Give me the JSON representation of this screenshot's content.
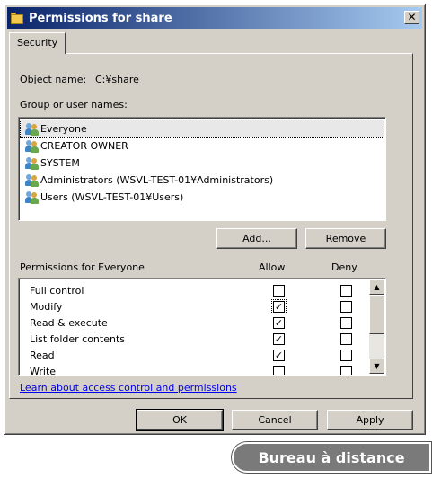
{
  "window": {
    "title": "Permissions for share"
  },
  "tabs": [
    {
      "label": "Security"
    }
  ],
  "object": {
    "label": "Object name:",
    "value": "C:¥share"
  },
  "group_label": "Group or user names:",
  "users": [
    {
      "name": "Everyone",
      "selected": true
    },
    {
      "name": "CREATOR OWNER"
    },
    {
      "name": "SYSTEM"
    },
    {
      "name": "Administrators (WSVL-TEST-01¥Administrators)"
    },
    {
      "name": "Users (WSVL-TEST-01¥Users)"
    }
  ],
  "buttons": {
    "add": "Add...",
    "remove": "Remove",
    "ok": "OK",
    "cancel": "Cancel",
    "apply": "Apply"
  },
  "permissions": {
    "header": "Permissions for Everyone",
    "allow_label": "Allow",
    "deny_label": "Deny",
    "rows": [
      {
        "name": "Full control",
        "allow": false,
        "deny": false
      },
      {
        "name": "Modify",
        "allow": true,
        "deny": false
      },
      {
        "name": "Read & execute",
        "allow": true,
        "deny": false
      },
      {
        "name": "List folder contents",
        "allow": true,
        "deny": false
      },
      {
        "name": "Read",
        "allow": true,
        "deny": false
      },
      {
        "name": "Write",
        "allow": false,
        "deny": false
      }
    ]
  },
  "link": "Learn about access control and permissions",
  "badge": "Bureau à distance",
  "colors": {
    "title_gradient_start": "#0a246a",
    "title_gradient_end": "#a6caf0",
    "dialog_bg": "#d4d0c8",
    "badge_bg": "#7a7a7a"
  }
}
